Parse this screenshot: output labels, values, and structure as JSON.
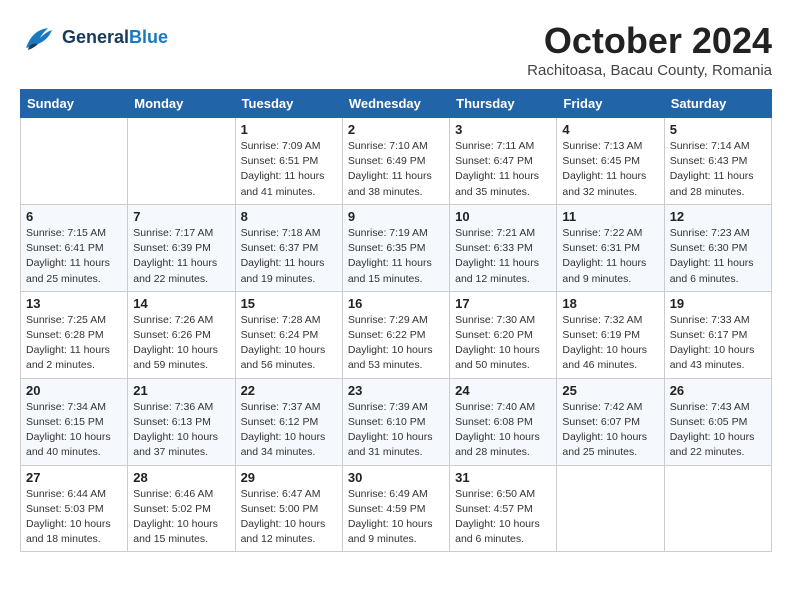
{
  "header": {
    "logo_line1": "General",
    "logo_line2": "Blue",
    "month": "October 2024",
    "location": "Rachitoasa, Bacau County, Romania"
  },
  "weekdays": [
    "Sunday",
    "Monday",
    "Tuesday",
    "Wednesday",
    "Thursday",
    "Friday",
    "Saturday"
  ],
  "weeks": [
    [
      {
        "day": "",
        "info": ""
      },
      {
        "day": "",
        "info": ""
      },
      {
        "day": "1",
        "info": "Sunrise: 7:09 AM\nSunset: 6:51 PM\nDaylight: 11 hours and 41 minutes."
      },
      {
        "day": "2",
        "info": "Sunrise: 7:10 AM\nSunset: 6:49 PM\nDaylight: 11 hours and 38 minutes."
      },
      {
        "day": "3",
        "info": "Sunrise: 7:11 AM\nSunset: 6:47 PM\nDaylight: 11 hours and 35 minutes."
      },
      {
        "day": "4",
        "info": "Sunrise: 7:13 AM\nSunset: 6:45 PM\nDaylight: 11 hours and 32 minutes."
      },
      {
        "day": "5",
        "info": "Sunrise: 7:14 AM\nSunset: 6:43 PM\nDaylight: 11 hours and 28 minutes."
      }
    ],
    [
      {
        "day": "6",
        "info": "Sunrise: 7:15 AM\nSunset: 6:41 PM\nDaylight: 11 hours and 25 minutes."
      },
      {
        "day": "7",
        "info": "Sunrise: 7:17 AM\nSunset: 6:39 PM\nDaylight: 11 hours and 22 minutes."
      },
      {
        "day": "8",
        "info": "Sunrise: 7:18 AM\nSunset: 6:37 PM\nDaylight: 11 hours and 19 minutes."
      },
      {
        "day": "9",
        "info": "Sunrise: 7:19 AM\nSunset: 6:35 PM\nDaylight: 11 hours and 15 minutes."
      },
      {
        "day": "10",
        "info": "Sunrise: 7:21 AM\nSunset: 6:33 PM\nDaylight: 11 hours and 12 minutes."
      },
      {
        "day": "11",
        "info": "Sunrise: 7:22 AM\nSunset: 6:31 PM\nDaylight: 11 hours and 9 minutes."
      },
      {
        "day": "12",
        "info": "Sunrise: 7:23 AM\nSunset: 6:30 PM\nDaylight: 11 hours and 6 minutes."
      }
    ],
    [
      {
        "day": "13",
        "info": "Sunrise: 7:25 AM\nSunset: 6:28 PM\nDaylight: 11 hours and 2 minutes."
      },
      {
        "day": "14",
        "info": "Sunrise: 7:26 AM\nSunset: 6:26 PM\nDaylight: 10 hours and 59 minutes."
      },
      {
        "day": "15",
        "info": "Sunrise: 7:28 AM\nSunset: 6:24 PM\nDaylight: 10 hours and 56 minutes."
      },
      {
        "day": "16",
        "info": "Sunrise: 7:29 AM\nSunset: 6:22 PM\nDaylight: 10 hours and 53 minutes."
      },
      {
        "day": "17",
        "info": "Sunrise: 7:30 AM\nSunset: 6:20 PM\nDaylight: 10 hours and 50 minutes."
      },
      {
        "day": "18",
        "info": "Sunrise: 7:32 AM\nSunset: 6:19 PM\nDaylight: 10 hours and 46 minutes."
      },
      {
        "day": "19",
        "info": "Sunrise: 7:33 AM\nSunset: 6:17 PM\nDaylight: 10 hours and 43 minutes."
      }
    ],
    [
      {
        "day": "20",
        "info": "Sunrise: 7:34 AM\nSunset: 6:15 PM\nDaylight: 10 hours and 40 minutes."
      },
      {
        "day": "21",
        "info": "Sunrise: 7:36 AM\nSunset: 6:13 PM\nDaylight: 10 hours and 37 minutes."
      },
      {
        "day": "22",
        "info": "Sunrise: 7:37 AM\nSunset: 6:12 PM\nDaylight: 10 hours and 34 minutes."
      },
      {
        "day": "23",
        "info": "Sunrise: 7:39 AM\nSunset: 6:10 PM\nDaylight: 10 hours and 31 minutes."
      },
      {
        "day": "24",
        "info": "Sunrise: 7:40 AM\nSunset: 6:08 PM\nDaylight: 10 hours and 28 minutes."
      },
      {
        "day": "25",
        "info": "Sunrise: 7:42 AM\nSunset: 6:07 PM\nDaylight: 10 hours and 25 minutes."
      },
      {
        "day": "26",
        "info": "Sunrise: 7:43 AM\nSunset: 6:05 PM\nDaylight: 10 hours and 22 minutes."
      }
    ],
    [
      {
        "day": "27",
        "info": "Sunrise: 6:44 AM\nSunset: 5:03 PM\nDaylight: 10 hours and 18 minutes."
      },
      {
        "day": "28",
        "info": "Sunrise: 6:46 AM\nSunset: 5:02 PM\nDaylight: 10 hours and 15 minutes."
      },
      {
        "day": "29",
        "info": "Sunrise: 6:47 AM\nSunset: 5:00 PM\nDaylight: 10 hours and 12 minutes."
      },
      {
        "day": "30",
        "info": "Sunrise: 6:49 AM\nSunset: 4:59 PM\nDaylight: 10 hours and 9 minutes."
      },
      {
        "day": "31",
        "info": "Sunrise: 6:50 AM\nSunset: 4:57 PM\nDaylight: 10 hours and 6 minutes."
      },
      {
        "day": "",
        "info": ""
      },
      {
        "day": "",
        "info": ""
      }
    ]
  ]
}
